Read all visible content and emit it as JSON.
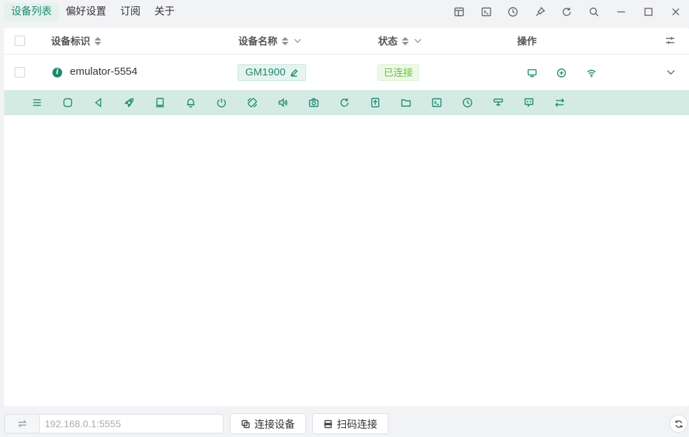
{
  "nav": {
    "tabs": [
      {
        "label": "设备列表",
        "active": true
      },
      {
        "label": "偏好设置"
      },
      {
        "label": "订阅"
      },
      {
        "label": "关于"
      }
    ]
  },
  "titlebar_tools": [
    "layout-icon",
    "terminal-icon",
    "clock-icon",
    "pin-icon",
    "reload-icon",
    "search-icon",
    "minimize-icon",
    "maximize-icon",
    "close-icon"
  ],
  "table": {
    "headers": {
      "device_id": "设备标识",
      "device_name": "设备名称",
      "status": "状态",
      "actions": "操作"
    },
    "rows": [
      {
        "device_id": "emulator-5554",
        "device_name": "GM1900",
        "status": "已连接",
        "actions": [
          "monitor-icon",
          "add-circle-icon",
          "wifi-icon"
        ]
      }
    ]
  },
  "device_toolbar": [
    "menu-icon",
    "home-icon",
    "back-icon",
    "rocket-icon",
    "notebook-icon",
    "bell-icon",
    "power-icon",
    "rotate-icon",
    "volume-icon",
    "camera-icon",
    "restart-icon",
    "upload-file-icon",
    "folder-icon",
    "terminal-icon",
    "history-icon",
    "settings-slider-icon",
    "message-icon",
    "switch-icon"
  ],
  "bottom": {
    "ip_placeholder": "192.168.0.1:5555",
    "connect_label": "连接设备",
    "qr_label": "扫码连接"
  },
  "colors": {
    "accent": "#1f8a70",
    "toolbar_bg": "#d4ebe4",
    "status_green": "#67c23a"
  }
}
